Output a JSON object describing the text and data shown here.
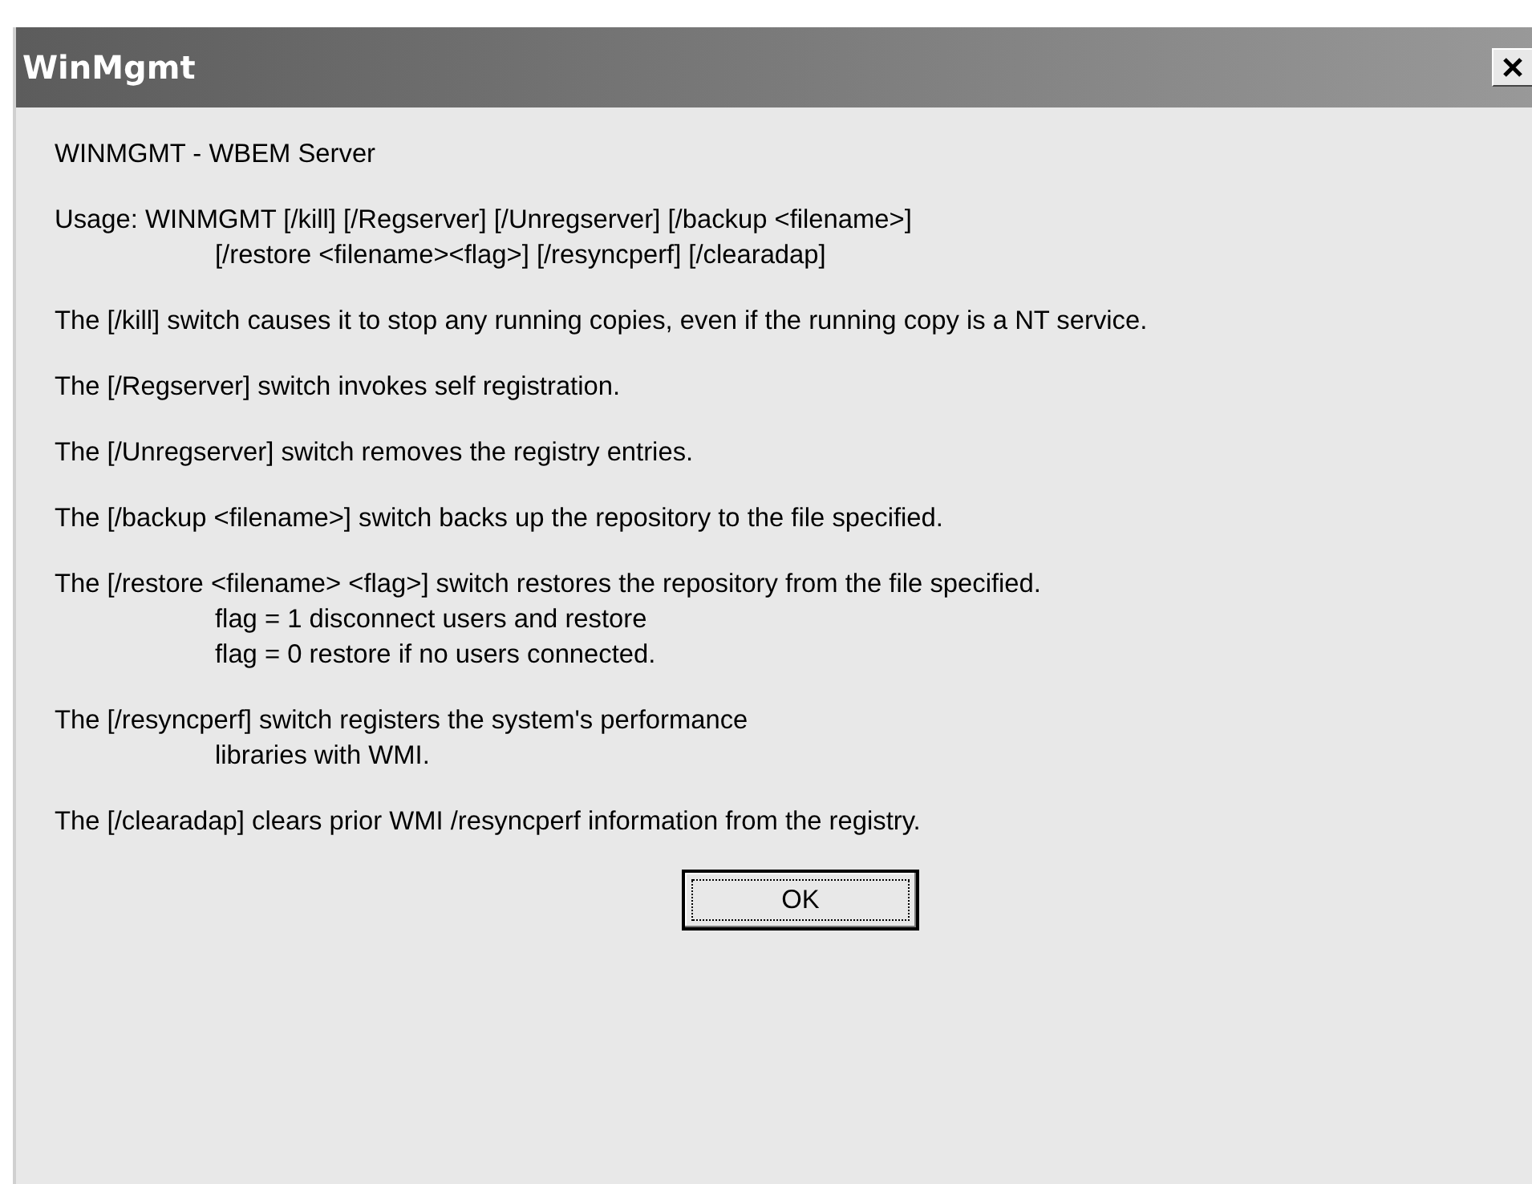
{
  "window": {
    "title": "WinMgmt"
  },
  "paragraphs": [
    {
      "lines": [
        "WINMGMT - WBEM Server"
      ]
    },
    {
      "lines": [
        "Usage: WINMGMT [/kill] [/Regserver] [/Unregserver] [/backup <filename>]",
        "[/restore <filename><flag>] [/resyncperf] [/clearadap]"
      ]
    },
    {
      "lines": [
        "The [/kill] switch causes it to stop any running copies, even if the running copy is a NT service."
      ]
    },
    {
      "lines": [
        "The [/Regserver] switch invokes self registration."
      ]
    },
    {
      "lines": [
        "The [/Unregserver] switch removes the registry entries."
      ]
    },
    {
      "lines": [
        "The [/backup <filename>] switch backs up the repository to the file specified."
      ]
    },
    {
      "lines": [
        "The [/restore <filename> <flag>] switch restores the repository from the file specified.",
        "flag = 1 disconnect users and restore",
        "flag = 0 restore if no users connected."
      ]
    },
    {
      "lines": [
        "The [/resyncperf] switch registers the system's performance",
        "libraries with WMI."
      ]
    },
    {
      "lines": [
        "The [/clearadap] clears prior WMI /resyncperf information from the registry."
      ]
    }
  ],
  "button": {
    "label": "OK",
    "focused": true
  }
}
